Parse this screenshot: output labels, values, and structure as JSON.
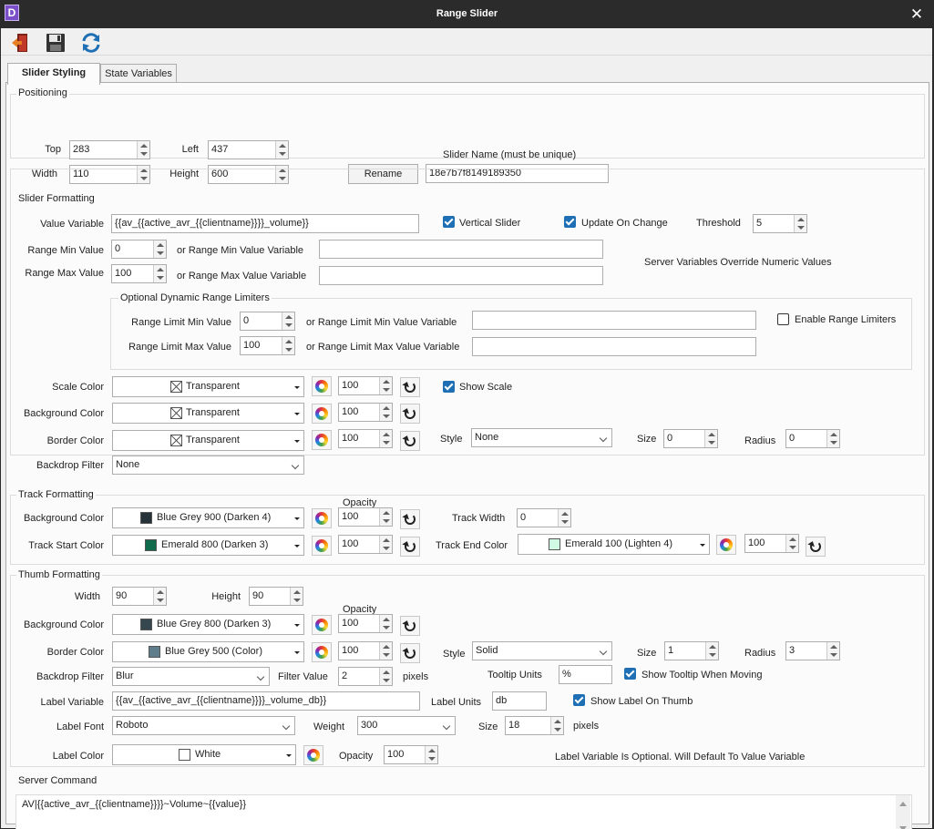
{
  "window": {
    "title": "Range Slider",
    "app_icon": "D",
    "close": "✕"
  },
  "toolbar": {
    "exit_icon": "exit-icon",
    "save_icon": "save-icon",
    "refresh_icon": "refresh-icon"
  },
  "tabs": [
    "Slider Styling",
    "State Variables"
  ],
  "positioning": {
    "legend": "Positioning",
    "top_label": "Top",
    "top": "283",
    "left_label": "Left",
    "left": "437",
    "width_label": "Width",
    "width": "110",
    "height_label": "Height",
    "height": "600",
    "name_label": "Slider Name (must be unique)",
    "rename": "Rename",
    "name": "18e7b7f8149189350"
  },
  "slider": {
    "legend": "Slider Formatting",
    "value_var_label": "Value Variable",
    "value_var": "{{av_{{active_avr_{{clientname}}}}_volume}}",
    "vertical_label": "Vertical Slider",
    "update_label": "Update On Change",
    "threshold_label": "Threshold",
    "threshold": "5",
    "min_label": "Range Min Value",
    "min": "0",
    "min_var_label": "or Range Min Value Variable",
    "min_var": "",
    "max_label": "Range Max Value",
    "max": "100",
    "max_var_label": "or Range Max Value Variable",
    "max_var": "",
    "override_note": "Server Variables Override Numeric Values",
    "limiters": {
      "legend": "Optional Dynamic Range Limiters",
      "min_label": "Range Limit Min Value",
      "min": "0",
      "min_var_label": "or Range Limit Min Value Variable",
      "min_var": "",
      "max_label": "Range Limit Max Value",
      "max": "100",
      "max_var_label": "or Range Limit Max Value Variable",
      "max_var": "",
      "enable_label": "Enable Range Limiters"
    },
    "scale_color_label": "Scale Color",
    "scale_color": "Transparent",
    "scale_opacity": "100",
    "show_scale_label": "Show Scale",
    "bg_color_label": "Background Color",
    "bg_color": "Transparent",
    "bg_opacity": "100",
    "border_color_label": "Border Color",
    "border_color": "Transparent",
    "border_opacity": "100",
    "style_label": "Style",
    "style": "None",
    "size_label": "Size",
    "size": "0",
    "radius_label": "Radius",
    "radius": "0",
    "backdrop_label": "Backdrop Filter",
    "backdrop": "None"
  },
  "track": {
    "legend": "Track Formatting",
    "opacity_label": "Opacity",
    "bg_label": "Background Color",
    "bg": "Blue Grey 900 (Darken 4)",
    "bg_swatch": "#263238",
    "bg_opacity": "100",
    "width_label": "Track Width",
    "width": "0",
    "start_label": "Track Start Color",
    "start": "Emerald 800 (Darken 3)",
    "start_swatch": "#0f6b4b",
    "start_opacity": "100",
    "end_label": "Track End Color",
    "end": "Emerald 100 (Lighten 4)",
    "end_swatch": "#d1fae5",
    "end_opacity": "100"
  },
  "thumb": {
    "legend": "Thumb Formatting",
    "width_label": "Width",
    "width": "90",
    "height_label": "Height",
    "height": "90",
    "opacity_label": "Opacity",
    "bg_label": "Background Color",
    "bg": "Blue Grey 800 (Darken 3)",
    "bg_swatch": "#37474f",
    "bg_opacity": "100",
    "border_label": "Border Color",
    "border": "Blue Grey 500 (Color)",
    "border_swatch": "#607d8b",
    "border_opacity": "100",
    "style_label": "Style",
    "style": "Solid",
    "size_label": "Size",
    "size": "1",
    "radius_label": "Radius",
    "radius": "3",
    "backdrop_label": "Backdrop Filter",
    "backdrop": "Blur",
    "filter_label": "Filter Value",
    "filter": "2",
    "filter_units": "pixels",
    "tooltip_units_label": "Tooltip Units",
    "tooltip_units": "%",
    "show_tooltip_label": "Show Tooltip When Moving",
    "label_var_label": "Label Variable",
    "label_var": "{{av_{{active_avr_{{clientname}}}}_volume_db}}",
    "label_units_label": "Label Units",
    "label_units": "db",
    "show_label_label": "Show Label On Thumb",
    "font_label": "Label Font",
    "font": "Roboto",
    "weight_label": "Weight",
    "weight": "300",
    "font_size_label": "Size",
    "font_size": "18",
    "font_size_units": "pixels",
    "label_color_label": "Label Color",
    "label_color": "White",
    "label_color_swatch": "#ffffff",
    "label_opacity_label": "Opacity",
    "label_opacity": "100",
    "note": "Label Variable Is Optional. Will Default To Value Variable"
  },
  "server": {
    "legend": "Server Command",
    "command": "AV|{{active_avr_{{clientname}}}}~Volume~{{value}}"
  }
}
